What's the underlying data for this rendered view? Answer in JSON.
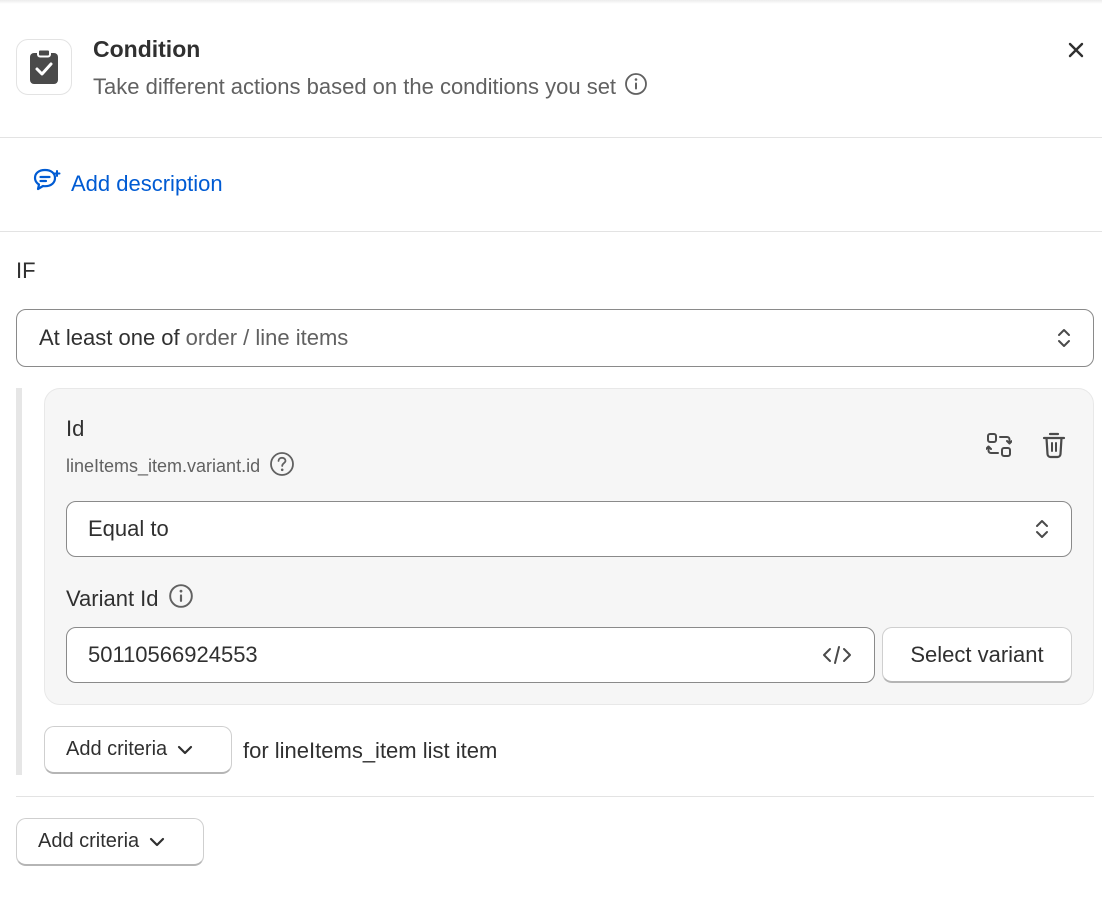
{
  "header": {
    "title": "Condition",
    "subtitle": "Take different actions based on the conditions you set",
    "icon": "clipboard-check-icon",
    "close_icon": "close-icon"
  },
  "description": {
    "add_label": "Add description",
    "icon": "chat-edit-icon"
  },
  "condition": {
    "if_label": "IF",
    "scope_select": {
      "prefix": "At least one of",
      "path": "order / line items"
    },
    "criterion": {
      "field_title": "Id",
      "field_path": "lineItems_item.variant.id",
      "operator": "Equal to",
      "value_label": "Variant Id",
      "value": "50110566924553",
      "select_variant_label": "Select variant"
    },
    "inner_add_criteria_label": "Add criteria",
    "inner_scope_text": "for lineItems_item list item",
    "outer_add_criteria_label": "Add criteria"
  },
  "colors": {
    "link": "#005bd3",
    "text": "#303030",
    "muted": "#616161",
    "border": "#8a8a8a",
    "card_bg": "#f6f6f6"
  }
}
